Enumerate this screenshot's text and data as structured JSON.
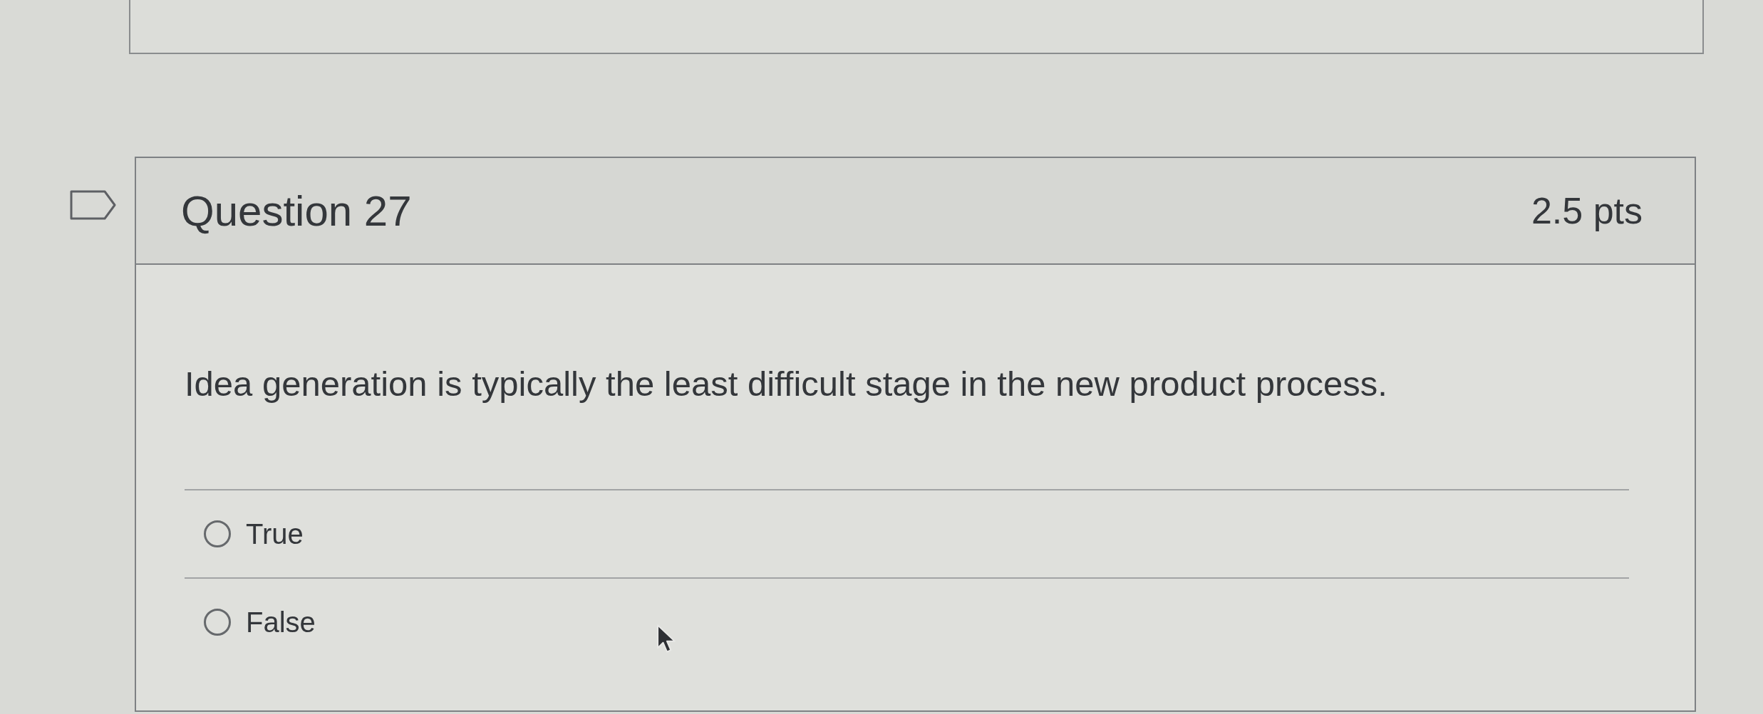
{
  "question": {
    "flagged": false,
    "title": "Question 27",
    "points": "2.5 pts",
    "text": "Idea generation is typically the least difficult stage in the new product process.",
    "answers": [
      {
        "label": "True",
        "selected": false
      },
      {
        "label": "False",
        "selected": false
      }
    ]
  }
}
